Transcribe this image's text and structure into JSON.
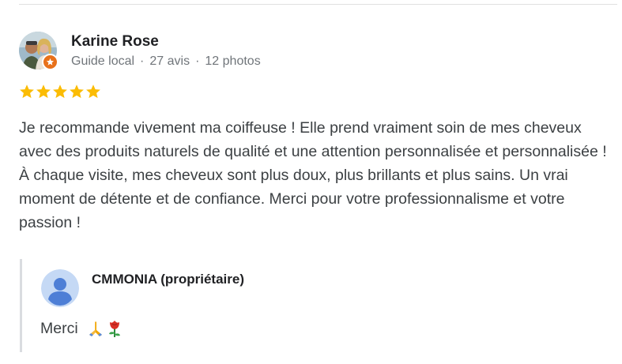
{
  "review": {
    "reviewer": {
      "name": "Karine Rose",
      "badge": "Guide local",
      "reviews_count": "27 avis",
      "photos_count": "12 photos",
      "separator": "·",
      "avatar_icon": "user-photo",
      "badge_icon": "local-guide-star-icon"
    },
    "rating": {
      "value": 5,
      "max": 5,
      "color": "#fbbc04"
    },
    "text": "Je recommande vivement ma coiffeuse ! Elle prend vraiment soin de mes cheveux avec des produits naturels de qualité et une attention personnalisée et personnalisée ! À chaque visite, mes cheveux sont plus doux, plus brillants et plus sains. Un vrai moment de détente et de confiance. Merci pour votre professionnalisme et votre passion !"
  },
  "owner_reply": {
    "owner_name": "CMMONIA (propriétaire)",
    "avatar_icon": "default-user-avatar",
    "text": "Merci",
    "emojis": [
      "folded-hands-icon",
      "rose-icon"
    ]
  },
  "colors": {
    "badge_orange": "#e8711a",
    "owner_avatar_bg": "#c5d9f5",
    "owner_avatar_fg": "#4e7fd6"
  }
}
